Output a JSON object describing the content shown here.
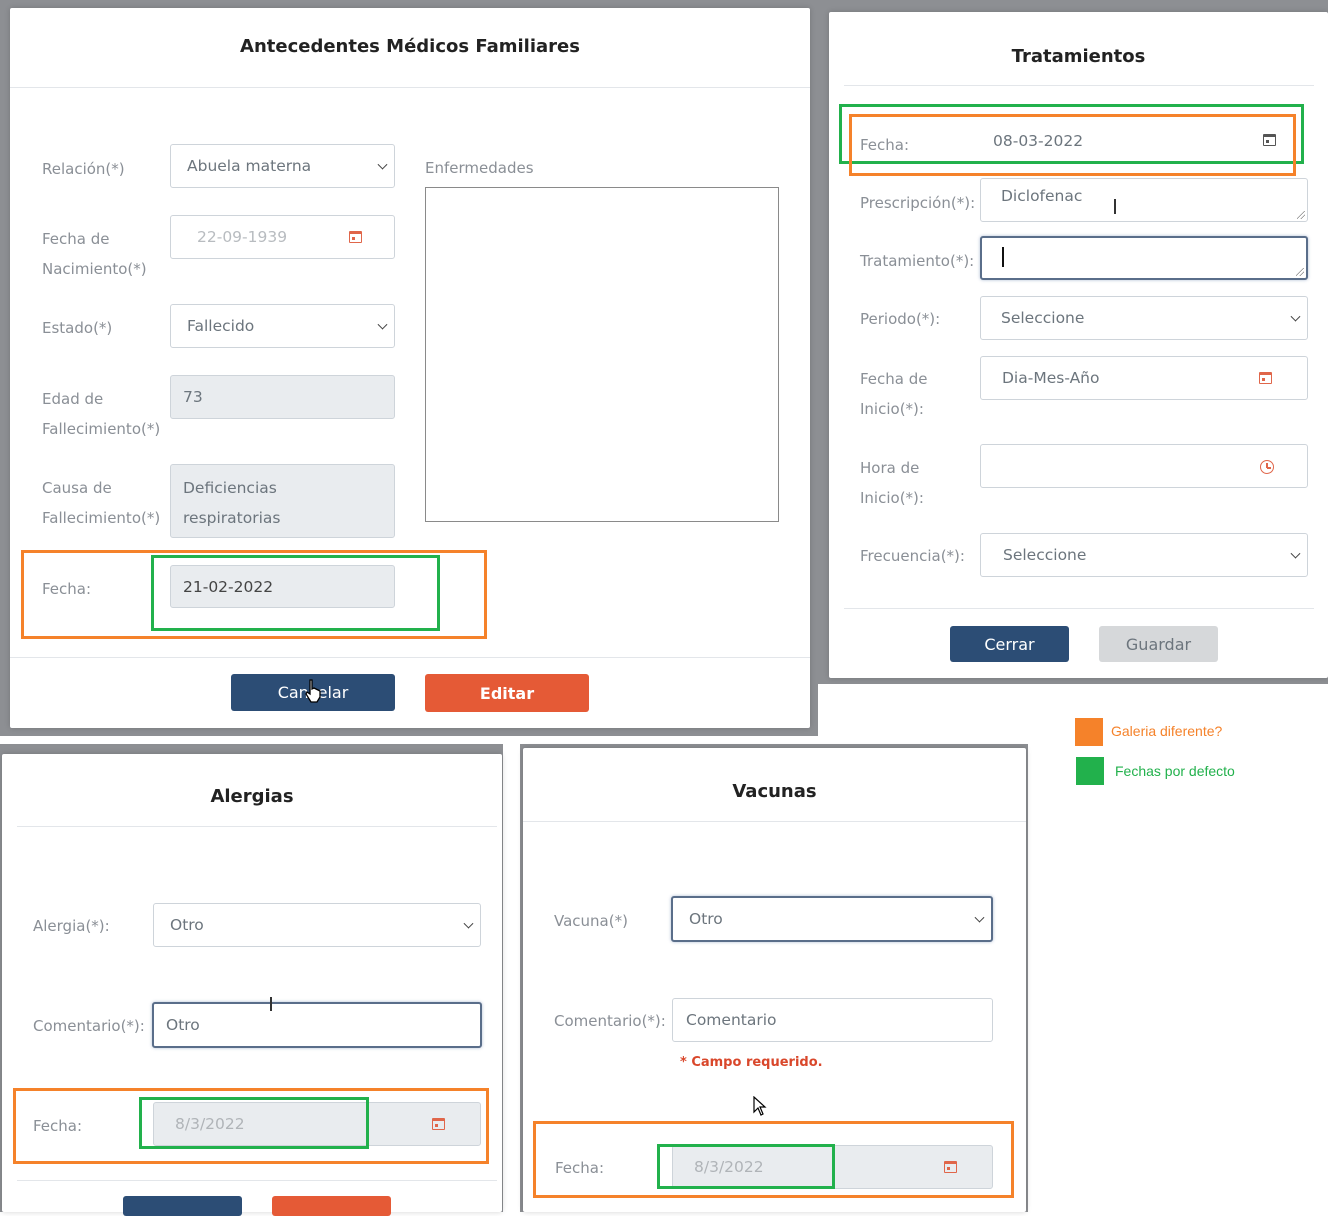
{
  "colors": {
    "orange_box": "#f5822a",
    "green_box": "#22b14c",
    "navy_button": "#2c4d75",
    "orange_button": "#e55a36",
    "icon_red": "#e0664a"
  },
  "antecedentes": {
    "title": "Antecedentes Médicos Familiares",
    "relacion_label": "Relación(*)",
    "relacion_value": "Abuela materna",
    "fecha_nac_label1": "Fecha de",
    "fecha_nac_label2": "Nacimiento(*)",
    "fecha_nac_value": "22-09-1939",
    "estado_label": "Estado(*)",
    "estado_value": "Fallecido",
    "edad_label1": "Edad de",
    "edad_label2": "Fallecimiento(*)",
    "edad_value": "73",
    "causa_label1": "Causa de",
    "causa_label2": "Fallecimiento(*)",
    "causa_value1": "Deficiencias",
    "causa_value2": "respiratorias",
    "enfermedades_label": "Enfermedades",
    "fecha_label": "Fecha:",
    "fecha_value": "21-02-2022",
    "cancel_label": "Cancelar",
    "edit_label": "Editar"
  },
  "tratamientos": {
    "title": "Tratamientos",
    "fecha_label": "Fecha:",
    "fecha_value": "08-03-2022",
    "prescripcion_label": "Prescripción(*):",
    "prescripcion_value": "Diclofenac",
    "tratamiento_label": "Tratamiento(*):",
    "tratamiento_value": "",
    "periodo_label": "Periodo(*):",
    "periodo_value": "Seleccione",
    "fecha_inicio_label1": "Fecha de",
    "fecha_inicio_label2": "Inicio(*):",
    "fecha_inicio_placeholder": "Dia-Mes-Año",
    "hora_label1": "Hora de",
    "hora_label2": "Inicio(*):",
    "frecuencia_label": "Frecuencia(*):",
    "frecuencia_value": "Seleccione",
    "close_label": "Cerrar",
    "save_label": "Guardar"
  },
  "alergias": {
    "title": "Alergias",
    "alergia_label": "Alergia(*):",
    "alergia_value": "Otro",
    "comentario_label": "Comentario(*):",
    "comentario_value": "Otro",
    "fecha_label": "Fecha:",
    "fecha_value": "8/3/2022"
  },
  "vacunas": {
    "title": "Vacunas",
    "vacuna_label": "Vacuna(*)",
    "vacuna_value": "Otro",
    "comentario_label": "Comentario(*):",
    "comentario_placeholder": "Comentario",
    "required_msg": "* Campo requerido.",
    "fecha_label": "Fecha:",
    "fecha_value": "8/3/2022"
  },
  "legend": {
    "orange_text": "Galeria diferente?",
    "green_text": "Fechas por defecto"
  }
}
